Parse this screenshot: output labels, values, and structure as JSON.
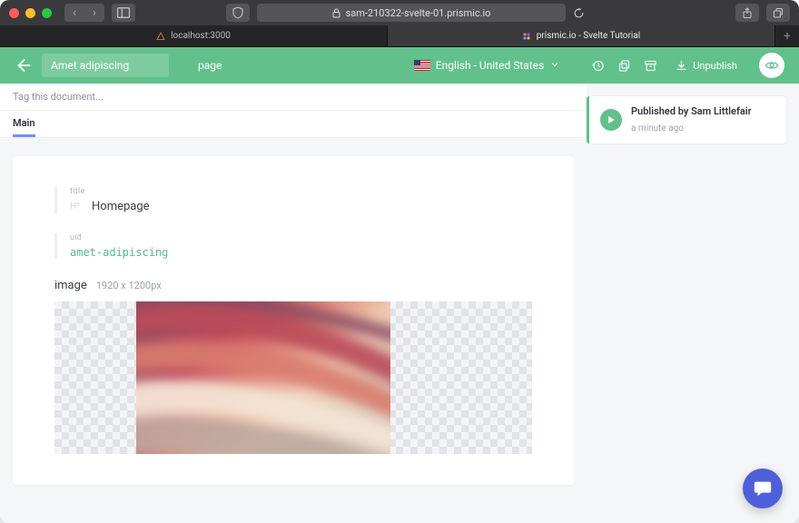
{
  "browser": {
    "url": "sam-210322-svelte-01.prismic.io",
    "tabs": [
      {
        "label": "localhost:3000"
      },
      {
        "label": "prismic.io - Svelte Tutorial"
      }
    ],
    "active_tab": 1
  },
  "header": {
    "doc_title": "Amet adipiscing",
    "doc_type": "page",
    "language": "English - United States",
    "unpublish_label": "Unpublish"
  },
  "tagbar": {
    "placeholder": "Tag this document..."
  },
  "tabs": {
    "main": "Main"
  },
  "fields": {
    "title": {
      "label": "title",
      "value": "Homepage"
    },
    "uid": {
      "label": "uid",
      "value": "amet-adipiscing"
    },
    "image": {
      "label": "image",
      "dimensions": "1920 x 1200px"
    }
  },
  "sidebar": {
    "published_by": "Published by Sam Littlefair",
    "when": "a minute ago"
  }
}
